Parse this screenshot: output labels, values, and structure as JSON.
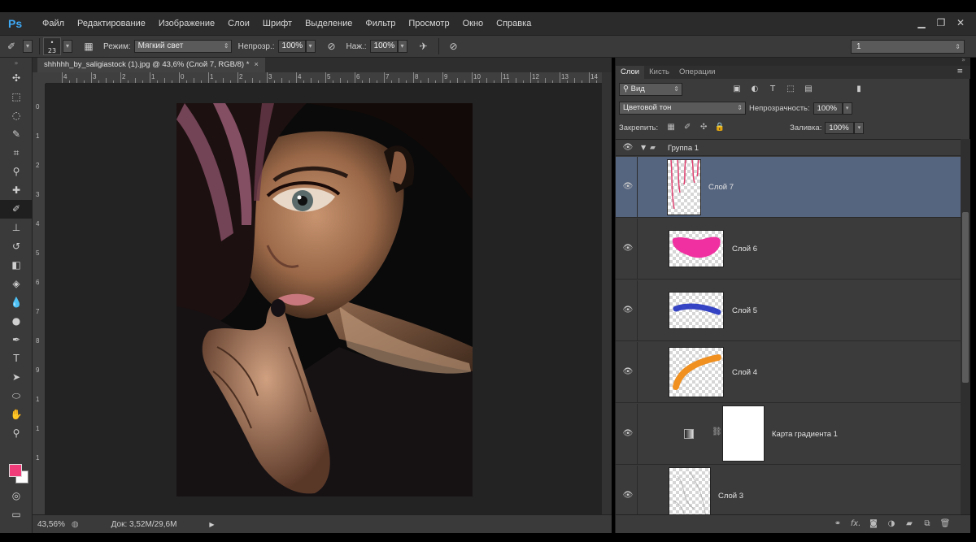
{
  "app": {
    "logo": "Ps"
  },
  "menu": [
    "Файл",
    "Редактирование",
    "Изображение",
    "Слои",
    "Шрифт",
    "Выделение",
    "Фильтр",
    "Просмотр",
    "Окно",
    "Справка"
  ],
  "window_controls": {
    "minimize": "▁",
    "restore": "❐",
    "close": "✕"
  },
  "options": {
    "brush_size": "23",
    "mode_label": "Режим:",
    "mode_value": "Мягкий свет",
    "opacity_label": "Непрозр.:",
    "opacity_value": "100%",
    "pressure_label": "Наж.:",
    "pressure_value": "100%",
    "workspace_value": "1"
  },
  "document": {
    "tab_title": "shhhhh_by_saligiastock (1).jpg @ 43,6% (Слой 7, RGB/8) *",
    "tab_close": "×",
    "zoom": "43,56%",
    "doc_size": "Док: 3,52M/29,6M",
    "ruler_h": [
      "4",
      "3",
      "2",
      "1",
      "0",
      "1",
      "2",
      "3",
      "4",
      "5",
      "6",
      "7",
      "8",
      "9",
      "10",
      "11",
      "12",
      "13",
      "14"
    ],
    "ruler_v": [
      "0",
      "1",
      "2",
      "3",
      "4",
      "5",
      "6",
      "7",
      "8",
      "9",
      "1",
      "1",
      "1"
    ]
  },
  "tools": [
    {
      "name": "move-tool",
      "glyph": "✣"
    },
    {
      "name": "marquee-tool",
      "glyph": "⬚"
    },
    {
      "name": "lasso-tool",
      "glyph": "◌"
    },
    {
      "name": "quick-select-tool",
      "glyph": "✎"
    },
    {
      "name": "crop-tool",
      "glyph": "⌗"
    },
    {
      "name": "eyedropper-tool",
      "glyph": "⚲"
    },
    {
      "name": "healing-tool",
      "glyph": "✚"
    },
    {
      "name": "brush-tool",
      "glyph": "✐"
    },
    {
      "name": "stamp-tool",
      "glyph": "⊥"
    },
    {
      "name": "history-brush-tool",
      "glyph": "↺"
    },
    {
      "name": "eraser-tool",
      "glyph": "◧"
    },
    {
      "name": "bucket-tool",
      "glyph": "◈"
    },
    {
      "name": "blur-tool",
      "glyph": "💧"
    },
    {
      "name": "dodge-tool",
      "glyph": "●"
    },
    {
      "name": "pen-tool",
      "glyph": "✒"
    },
    {
      "name": "type-tool",
      "glyph": "T"
    },
    {
      "name": "path-select-tool",
      "glyph": "➤"
    },
    {
      "name": "shape-tool",
      "glyph": "⬭"
    },
    {
      "name": "hand-tool",
      "glyph": "✋"
    },
    {
      "name": "zoom-tool",
      "glyph": "⚲"
    }
  ],
  "colors": {
    "foreground": "#f03c78",
    "background": "#ffffff",
    "selection": "#56657f"
  },
  "layers_panel": {
    "tabs": [
      "Слои",
      "Кисть",
      "Операции"
    ],
    "filter_value": "Вид",
    "blend_mode": "Цветовой тон",
    "opacity_label": "Непрозрачность:",
    "opacity_value": "100%",
    "lock_label": "Закрепить:",
    "fill_label": "Заливка:",
    "fill_value": "100%",
    "group_name": "Группа 1",
    "layers": [
      {
        "name": "Слой 7",
        "selected": true
      },
      {
        "name": "Слой 6",
        "selected": false
      },
      {
        "name": "Слой 5",
        "selected": false
      },
      {
        "name": "Слой 4",
        "selected": false
      },
      {
        "name": "Карта градиента 1",
        "selected": false
      },
      {
        "name": "Слой 3",
        "selected": false
      }
    ],
    "footer_icons": [
      "link-icon",
      "fx-icon",
      "mask-icon",
      "adjustment-icon",
      "folder-icon",
      "new-layer-icon",
      "trash-icon"
    ]
  }
}
